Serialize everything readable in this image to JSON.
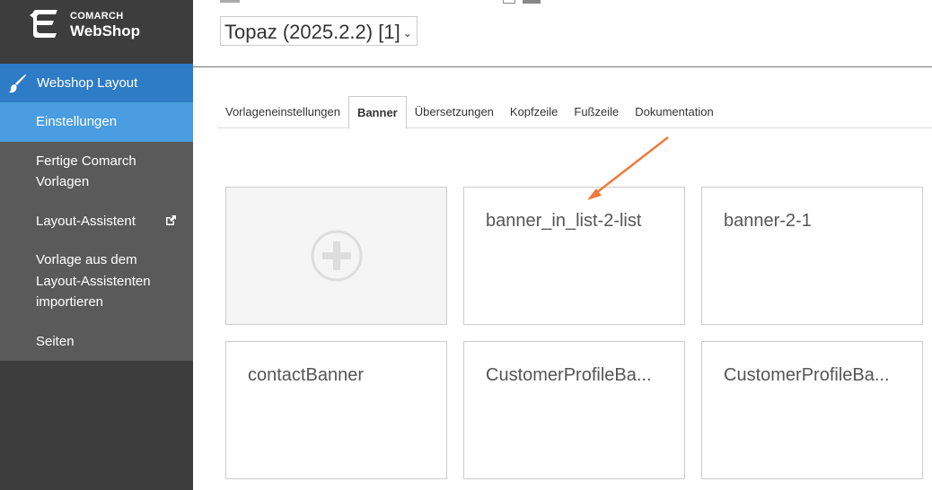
{
  "logo": {
    "brand": "COMARCH",
    "product": "WebShop"
  },
  "sidebar": {
    "section_label": "Webshop Layout",
    "items": [
      {
        "label": "Einstellungen",
        "active": true
      },
      {
        "label": "Fertige Comarch Vorlagen"
      },
      {
        "label": "Layout-Assistent",
        "external": true
      },
      {
        "label": "Vorlage aus dem Layout-Assistenten importieren"
      },
      {
        "label": "Seiten"
      }
    ]
  },
  "header": {
    "template_select": "Topaz (2025.2.2) [1]"
  },
  "tabs": [
    {
      "label": "Vorlageneinstellungen"
    },
    {
      "label": "Banner",
      "active": true
    },
    {
      "label": "Übersetzungen"
    },
    {
      "label": "Kopfzeile"
    },
    {
      "label": "Fußzeile"
    },
    {
      "label": "Dokumentation"
    }
  ],
  "banners": [
    {
      "title": "banner_in_list-2-list"
    },
    {
      "title": "banner-2-1"
    },
    {
      "title": "contactBanner"
    },
    {
      "title": "CustomerProfileBa..."
    },
    {
      "title": "CustomerProfileBa..."
    }
  ],
  "colors": {
    "accent": "#2f7cc6",
    "active_item": "#4a9de0",
    "sidebar": "#5a5a5a",
    "arrow": "#f07a3c"
  }
}
